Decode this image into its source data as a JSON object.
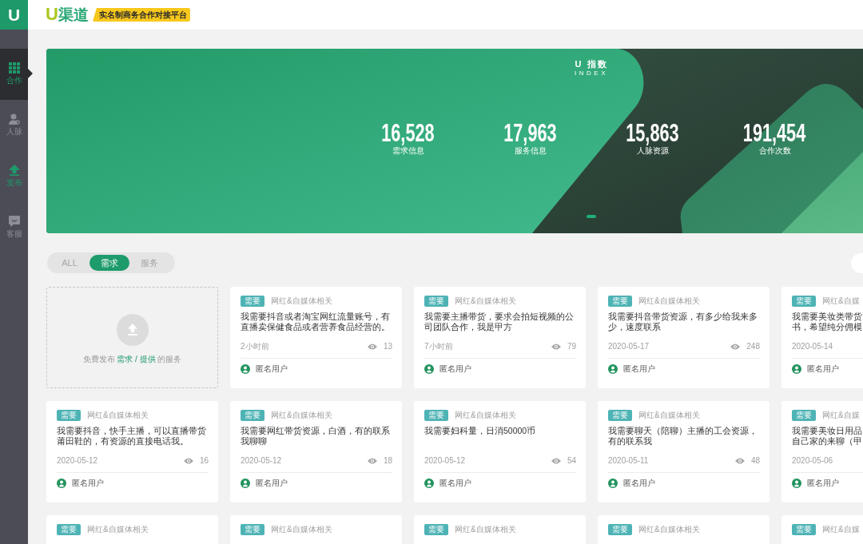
{
  "header": {
    "logo_mark": "U",
    "logo_text": "渠道",
    "slogan": "实名制商务合作对接平台"
  },
  "sidebar": {
    "logo": "U",
    "items": [
      {
        "label": "合作",
        "selected": true,
        "accent": false
      },
      {
        "label": "人脉",
        "selected": false,
        "accent": false
      },
      {
        "label": "发布",
        "selected": false,
        "accent": true
      },
      {
        "label": "客服",
        "selected": false,
        "accent": false
      }
    ]
  },
  "banner": {
    "title": "U 指数",
    "subtitle": "INDEX",
    "stats": [
      {
        "value": "16,528",
        "label": "需求信息"
      },
      {
        "value": "17,963",
        "label": "服务信息"
      },
      {
        "value": "15,863",
        "label": "人脉资源"
      },
      {
        "value": "191,454",
        "label": "合作次数"
      }
    ]
  },
  "filter": {
    "tabs": [
      {
        "label": "ALL",
        "selected": false
      },
      {
        "label": "需求",
        "selected": true
      },
      {
        "label": "服务",
        "selected": false
      }
    ]
  },
  "publish_card": {
    "text_before": "免费发布",
    "links": [
      "需求",
      "提供"
    ],
    "separator": "/",
    "text_after": "的服务"
  },
  "cards": [
    {
      "tag": "需要",
      "category": "网红&自媒体相关",
      "description": [
        "我需要抖音或者淘宝网红流量账号，有",
        "直播卖保健食品或者营养食品经营的。"
      ],
      "time": "2小时前",
      "views": "13",
      "user": "匿名用户"
    },
    {
      "tag": "需要",
      "category": "网红&自媒体相关",
      "description": [
        "我需要主播带货，要求会拍短视频的公",
        "司团队合作，我是甲方"
      ],
      "time": "7小时前",
      "views": "79",
      "user": "匿名用户"
    },
    {
      "tag": "需要",
      "category": "网红&自媒体相关",
      "description": [
        "我需要抖音带货资源，有多少给我来多",
        "少，速度联系"
      ],
      "time": "2020-05-17",
      "views": "248",
      "user": "匿名用户"
    },
    {
      "tag": "需要",
      "category": "网红&自媒",
      "description": [
        "我需要美妆类带货",
        "书，希望纯分佣模"
      ],
      "time": "2020-05-14",
      "user": "匿名用户"
    },
    {
      "tag": "需要",
      "category": "网红&自媒体相关",
      "description": [
        "我需要抖音，快手主播，可以直播带货",
        "莆田鞋的，有资源的直接电话我。"
      ],
      "time": "2020-05-12",
      "views": "16",
      "user": "匿名用户"
    },
    {
      "tag": "需要",
      "category": "网红&自媒体相关",
      "description": [
        "我需要网红带货资源，白酒，有的联系",
        "我聊聊"
      ],
      "time": "2020-05-12",
      "views": "18",
      "user": "匿名用户"
    },
    {
      "tag": "需要",
      "category": "网红&自媒体相关",
      "description": [
        "我需要妇科量，日消50000币"
      ],
      "time": "2020-05-12",
      "views": "54",
      "user": "匿名用户"
    },
    {
      "tag": "需要",
      "category": "网红&自媒体相关",
      "description": [
        "我需要聊天（陪聊）主播的工会资源，",
        "有的联系我"
      ],
      "time": "2020-05-11",
      "views": "48",
      "user": "匿名用户"
    },
    {
      "tag": "需要",
      "category": "网红&自媒",
      "description": [
        "我需要美妆日用品",
        "自己家的来聊（甲"
      ],
      "time": "2020-05-06",
      "user": "匿名用户"
    },
    {
      "tag": "需要",
      "category": "网红&自媒体相关"
    },
    {
      "tag": "需要",
      "category": "网红&自媒体相关"
    },
    {
      "tag": "需要",
      "category": "网红&自媒体相关"
    },
    {
      "tag": "需要",
      "category": "网红&自媒体相关"
    },
    {
      "tag": "需要",
      "category": "网红&自媒"
    }
  ]
}
